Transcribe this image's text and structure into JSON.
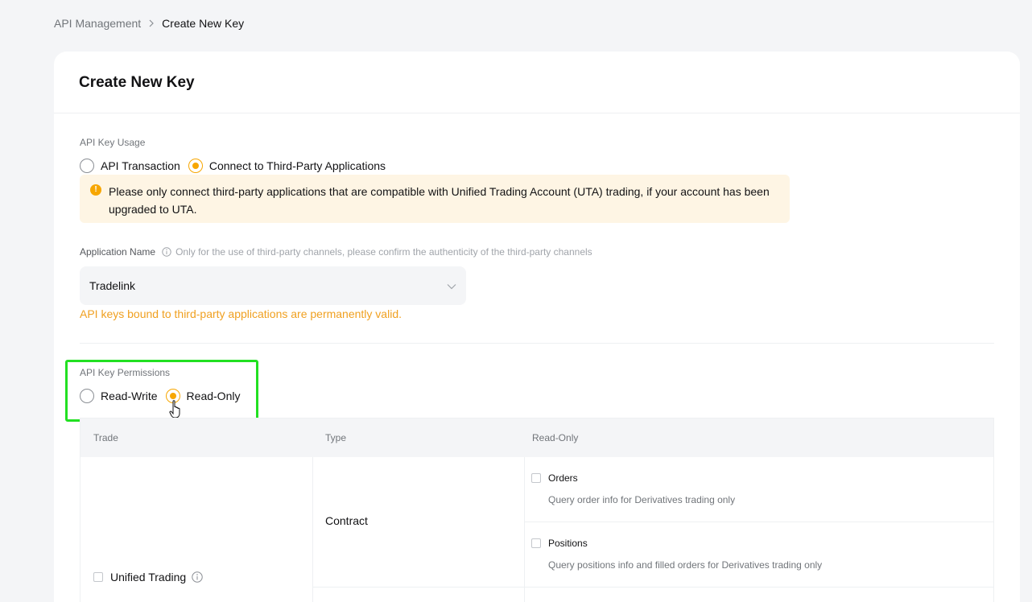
{
  "breadcrumb": {
    "parent": "API Management",
    "current": "Create New Key"
  },
  "card": {
    "title": "Create New Key"
  },
  "usage": {
    "label": "API Key Usage",
    "options": [
      "API Transaction",
      "Connect to Third-Party Applications"
    ],
    "selected": "Connect to Third-Party Applications"
  },
  "warning": {
    "text": "Please only connect third-party applications that are compatible with Unified Trading Account (UTA) trading, if your account has been upgraded to UTA."
  },
  "application": {
    "label": "Application Name",
    "hint": "Only for the use of third-party channels, please confirm the authenticity of the third-party channels",
    "selected": "Tradelink",
    "note": "API keys bound to third-party applications are permanently valid."
  },
  "permissions": {
    "label": "API Key Permissions",
    "options": [
      "Read-Write",
      "Read-Only"
    ],
    "selected": "Read-Only"
  },
  "table": {
    "headers": [
      "Trade",
      "Type",
      "Read-Only"
    ],
    "trade_item": "Unified Trading",
    "type": "Contract",
    "perms": [
      {
        "title": "Orders",
        "desc": "Query order info for Derivatives trading only"
      },
      {
        "title": "Positions",
        "desc": "Query positions info and filled orders for Derivatives trading only"
      }
    ]
  },
  "colors": {
    "accent": "#f7a600",
    "highlight": "#22e022",
    "warning_bg": "#fef5e4"
  }
}
